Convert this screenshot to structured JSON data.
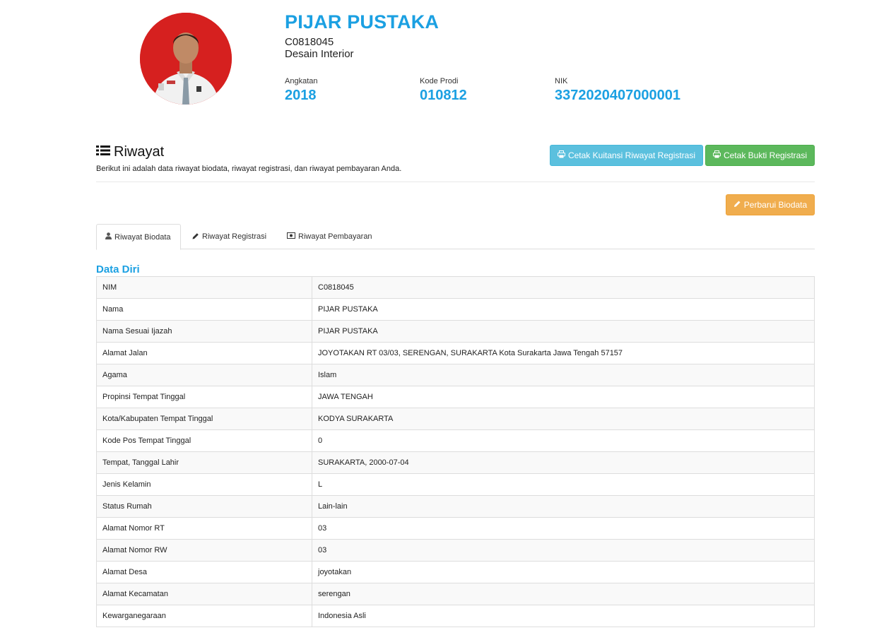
{
  "profile": {
    "name": "PIJAR PUSTAKA",
    "nim": "C0818045",
    "prodi": "Desain Interior",
    "stats": {
      "angkatan_label": "Angkatan",
      "angkatan_value": "2018",
      "kode_label": "Kode Prodi",
      "kode_value": "010812",
      "nik_label": "NIK",
      "nik_value": "3372020407000001"
    }
  },
  "riwayat": {
    "title": "Riwayat",
    "description": "Berikut ini adalah data riwayat biodata, riwayat registrasi, dan riwayat pembayaran Anda.",
    "buttons": {
      "kuitansi": "Cetak Kuitansi Riwayat Registrasi",
      "bukti": "Cetak Bukti Registrasi",
      "perbarui": "Perbarui Biodata"
    }
  },
  "tabs": [
    {
      "label": "Riwayat Biodata",
      "icon": "user-icon",
      "active": true
    },
    {
      "label": "Riwayat Registrasi",
      "icon": "pencil-icon",
      "active": false
    },
    {
      "label": "Riwayat Pembayaran",
      "icon": "money-icon",
      "active": false
    }
  ],
  "section": {
    "title": "Data Diri",
    "rows": [
      {
        "key": "NIM",
        "value": "C0818045"
      },
      {
        "key": "Nama",
        "value": "PIJAR PUSTAKA"
      },
      {
        "key": "Nama Sesuai Ijazah",
        "value": "PIJAR PUSTAKA"
      },
      {
        "key": "Alamat Jalan",
        "value": "JOYOTAKAN RT 03/03, SERENGAN, SURAKARTA Kota Surakarta Jawa Tengah 57157"
      },
      {
        "key": "Agama",
        "value": "Islam"
      },
      {
        "key": "Propinsi Tempat Tinggal",
        "value": "JAWA TENGAH"
      },
      {
        "key": "Kota/Kabupaten Tempat Tinggal",
        "value": "KODYA SURAKARTA"
      },
      {
        "key": "Kode Pos Tempat Tinggal",
        "value": "0"
      },
      {
        "key": "Tempat, Tanggal Lahir",
        "value": "SURAKARTA, 2000-07-04"
      },
      {
        "key": "Jenis Kelamin",
        "value": "L"
      },
      {
        "key": "Status Rumah",
        "value": "Lain-lain"
      },
      {
        "key": "Alamat Nomor RT",
        "value": "03"
      },
      {
        "key": "Alamat Nomor RW",
        "value": "03"
      },
      {
        "key": "Alamat Desa",
        "value": "joyotakan"
      },
      {
        "key": "Alamat Kecamatan",
        "value": "serengan"
      },
      {
        "key": "Kewarganegaraan",
        "value": "Indonesia Asli"
      }
    ]
  },
  "colors": {
    "accent": "#1ba0e2",
    "info": "#5bc0de",
    "success": "#5cb85c",
    "warning": "#f0ad4e"
  }
}
